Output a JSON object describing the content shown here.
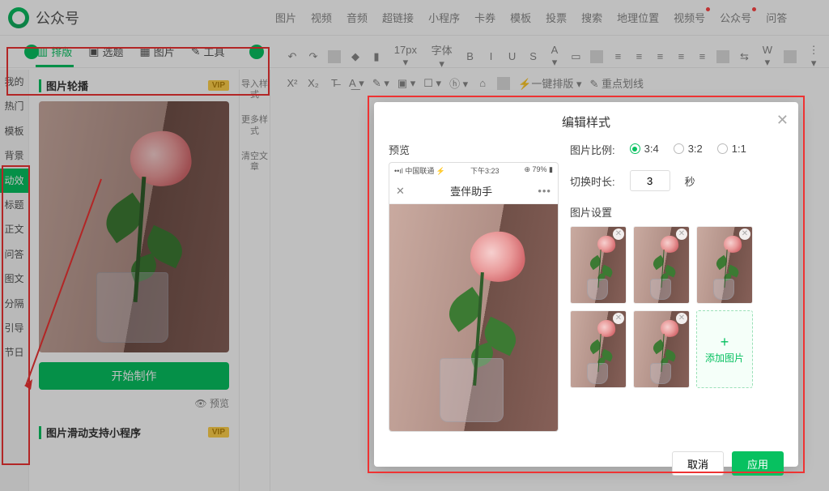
{
  "header": {
    "title": "公众号"
  },
  "topmenu": [
    "图片",
    "视频",
    "音频",
    "超链接",
    "小程序",
    "卡券",
    "模板",
    "投票",
    "搜索",
    "地理位置",
    "视频号",
    "公众号",
    "问答"
  ],
  "topmenu_dots": [
    10,
    11
  ],
  "tabs": [
    {
      "label": "排版",
      "icon": "▥"
    },
    {
      "label": "选题",
      "icon": "▣"
    },
    {
      "label": "图片",
      "icon": "▦"
    },
    {
      "label": "工具",
      "icon": "✎"
    }
  ],
  "toolbar1": [
    "↶",
    "↷",
    "|",
    "◆",
    "▮",
    "17px ▾",
    "字体 ▾",
    "B",
    "I",
    "U",
    "S",
    "A ▾",
    "▭",
    "|",
    "≡",
    "≡",
    "≡",
    "≡",
    "≡",
    "|",
    "⇆",
    "W ▾",
    "|",
    "⋮ ▾"
  ],
  "toolbar2": [
    "X²",
    "X₂",
    "T̶",
    "A͟ ▾",
    "✎ ▾",
    "▣ ▾",
    "☐ ▾",
    "ⓗ ▾",
    "⌂",
    "|",
    "⚡一键排版 ▾",
    "✎ 重点划线"
  ],
  "leftnav": [
    "我的",
    "热门",
    "模板",
    "背景",
    "动效",
    "标题",
    "正文",
    "问答",
    "图文",
    "分隔",
    "引导",
    "节日"
  ],
  "leftnav_active": 4,
  "panel": {
    "title": "图片轮播",
    "vip": "VIP",
    "start": "开始制作",
    "preview": "👁 预览",
    "title2": "图片滑动支持小程序"
  },
  "side_tools": [
    "导入样式",
    "更多样式",
    "清空文章"
  ],
  "modal": {
    "title": "编辑样式",
    "preview_label": "预览",
    "phone": {
      "carrier": "中国联通",
      "time": "下午3:23",
      "battery": "79%",
      "app": "壹伴助手"
    },
    "ratio_label": "图片比例:",
    "ratios": [
      "3:4",
      "3:2",
      "1:1"
    ],
    "ratio_sel": 0,
    "duration_label": "切换时长:",
    "duration_value": "3",
    "duration_unit": "秒",
    "thumbs_label": "图片设置",
    "thumb_count": 5,
    "add_label": "添加图片",
    "cancel": "取消",
    "apply": "应用"
  }
}
